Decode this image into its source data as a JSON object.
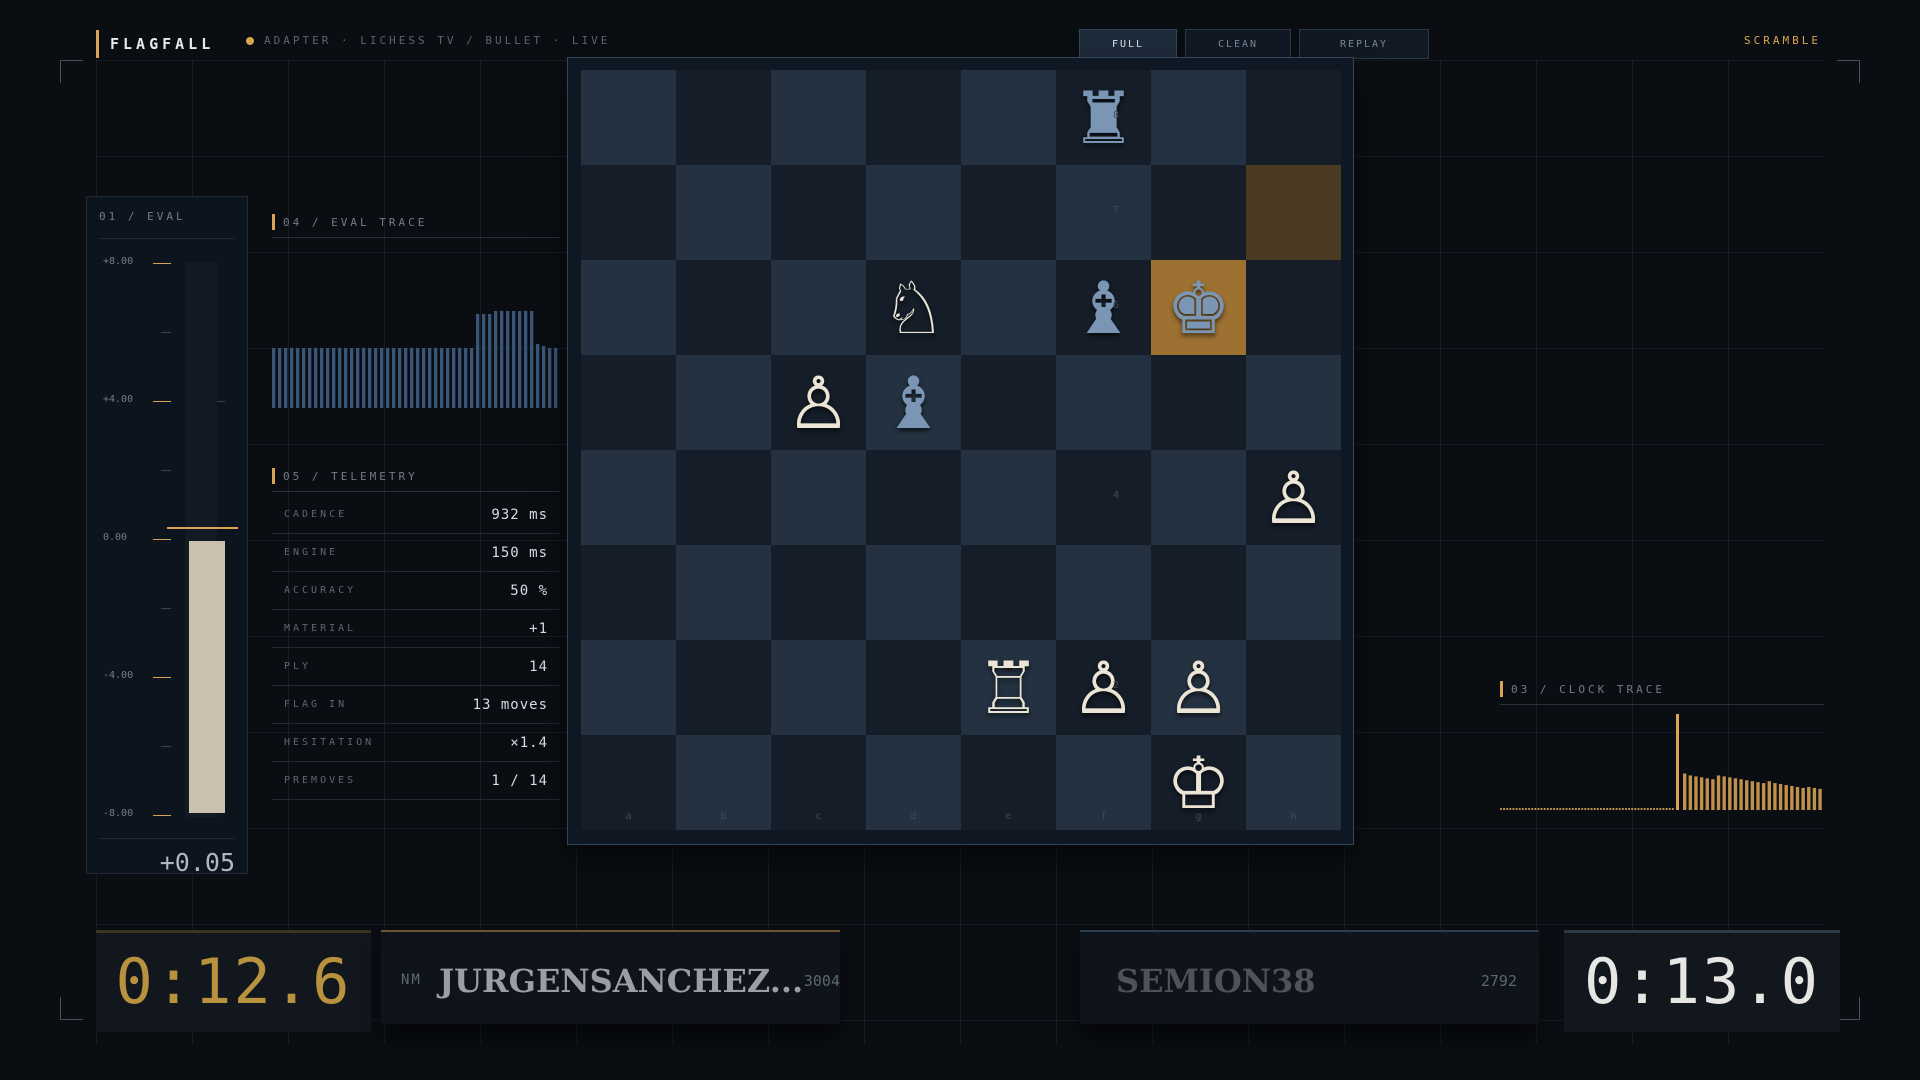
{
  "header": {
    "brand": "FLAGFALL",
    "adapter": "ADAPTER · LICHESS TV / BULLET · LIVE",
    "modes": [
      {
        "label": "FULL",
        "active": true
      },
      {
        "label": "CLEAN",
        "active": false
      },
      {
        "label": "REPLAY",
        "active": false
      }
    ],
    "scramble": "SCRAMBLE"
  },
  "eval_panel": {
    "title": "01 / EVAL",
    "ticks": [
      "+8.00",
      "+4.00",
      "0.00",
      "-4.00",
      "-8.00"
    ],
    "value": "+0.05",
    "fill_fraction": 0.497
  },
  "eval_trace": {
    "title": "04 / EVAL TRACE",
    "bars": [
      0.6,
      0.6,
      0.6,
      0.6,
      0.6,
      0.6,
      0.6,
      0.6,
      0.6,
      0.6,
      0.6,
      0.6,
      0.6,
      0.6,
      0.6,
      0.6,
      0.6,
      0.6,
      0.6,
      0.6,
      0.6,
      0.6,
      0.6,
      0.6,
      0.6,
      0.6,
      0.6,
      0.6,
      0.6,
      0.6,
      0.6,
      0.6,
      0.6,
      0.6,
      0.94,
      0.94,
      0.94,
      0.97,
      0.97,
      0.97,
      0.97,
      0.97,
      0.97,
      0.97,
      0.64,
      0.62,
      0.6,
      0.6
    ]
  },
  "telemetry": {
    "title": "05 / TELEMETRY",
    "rows": [
      {
        "label": "CADENCE",
        "value": "932 ms"
      },
      {
        "label": "ENGINE",
        "value": "150 ms"
      },
      {
        "label": "ACCURACY",
        "value": "50 %"
      },
      {
        "label": "MATERIAL",
        "value": "+1"
      },
      {
        "label": "PLY",
        "value": "14"
      },
      {
        "label": "FLAG IN",
        "value": "13 moves"
      },
      {
        "label": "HESITATION",
        "value": "×1.4"
      },
      {
        "label": "PREMOVES",
        "value": "1 / 14"
      }
    ]
  },
  "board": {
    "files": [
      "a",
      "b",
      "c",
      "d",
      "e",
      "f",
      "g",
      "h"
    ],
    "ranks": [
      "8",
      "7",
      "6",
      "4",
      "2"
    ],
    "squares": [
      [
        "",
        "",
        "",
        "",
        "",
        "♜",
        "",
        ""
      ],
      [
        "",
        "",
        "",
        "",
        "",
        "",
        "",
        ""
      ],
      [
        "",
        "",
        "",
        "♘",
        "",
        "♝",
        "♚",
        ""
      ],
      [
        "",
        "",
        "♙",
        "♝",
        "",
        "",
        "",
        ""
      ],
      [
        "",
        "",
        "",
        "",
        "",
        "",
        "",
        "♙"
      ],
      [
        "",
        "",
        "",
        "",
        "",
        "",
        "",
        ""
      ],
      [
        "",
        "",
        "",
        "",
        "♖",
        "♙",
        "♙",
        ""
      ],
      [
        "",
        "",
        "",
        "",
        "",
        "",
        "♔",
        ""
      ]
    ],
    "last_move_square": "h7",
    "highlight_square": "g6"
  },
  "clock_trace": {
    "title": "03 / CLOCK TRACE",
    "dashes": 56,
    "spike": 1.0,
    "bars": [
      0.38,
      0.36,
      0.35,
      0.34,
      0.33,
      0.32,
      0.36,
      0.35,
      0.34,
      0.33,
      0.32,
      0.31,
      0.3,
      0.29,
      0.28,
      0.3,
      0.28,
      0.27,
      0.26,
      0.25,
      0.24,
      0.23,
      0.24,
      0.23,
      0.22
    ]
  },
  "players": {
    "white": {
      "clock": "0:12.6",
      "title": "NM",
      "name": "JURGENSANCHEZ...",
      "rating": "3004"
    },
    "black": {
      "clock": "0:13.0",
      "name": "SEMION38",
      "rating": "2792"
    }
  },
  "colors": {
    "accent": "#d9a552",
    "white_clock": "#b8923e",
    "black_clock": "#e6e6e3",
    "white_piece": "#ece5d6",
    "black_piece": "#7b96b4"
  }
}
